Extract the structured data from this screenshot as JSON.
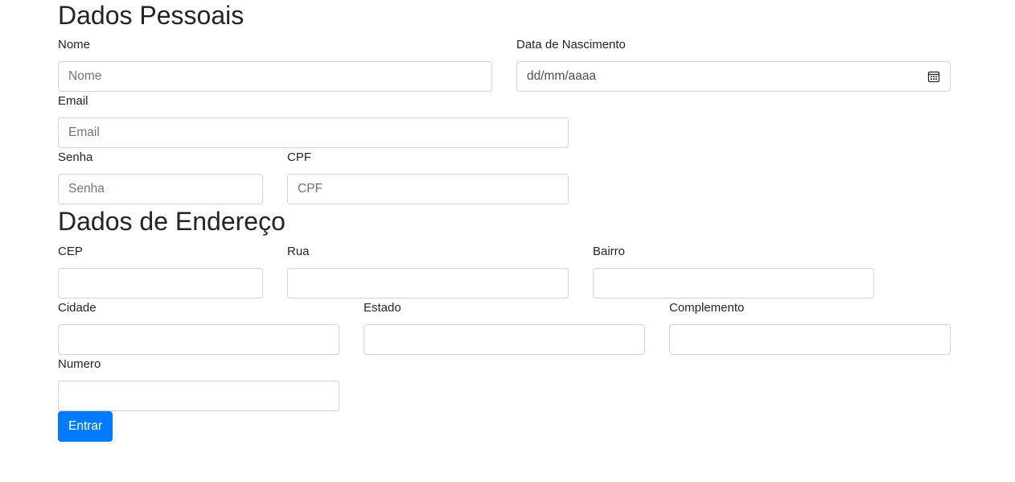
{
  "personal": {
    "title": "Dados Pessoais",
    "nome": {
      "label": "Nome",
      "placeholder": "Nome"
    },
    "nascimento": {
      "label": "Data de Nascimento",
      "value": "dd/mm/aaaa",
      "icon": "calendar-icon"
    },
    "email": {
      "label": "Email",
      "placeholder": "Email"
    },
    "senha": {
      "label": "Senha",
      "placeholder": "Senha"
    },
    "cpf": {
      "label": "CPF",
      "placeholder": "CPF"
    }
  },
  "address": {
    "title": "Dados de Endereço",
    "cep": {
      "label": "CEP"
    },
    "rua": {
      "label": "Rua"
    },
    "bairro": {
      "label": "Bairro"
    },
    "cidade": {
      "label": "Cidade"
    },
    "estado": {
      "label": "Estado"
    },
    "complemento": {
      "label": "Complemento"
    },
    "numero": {
      "label": "Numero"
    }
  },
  "submit": {
    "label": "Entrar",
    "color": "#007bff"
  }
}
